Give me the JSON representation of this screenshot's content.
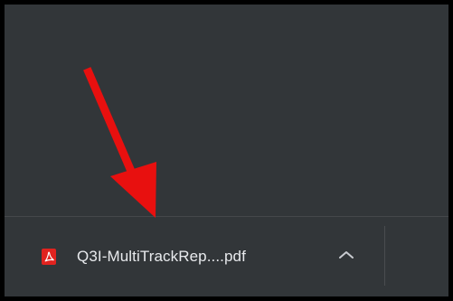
{
  "download_shelf": {
    "file_name": "Q3I-MultiTrackRep....pdf",
    "file_type_icon": "pdf-file-icon",
    "more_options_icon": "chevron-up-icon"
  },
  "annotation": {
    "arrow_icon": "red-arrow-annotation",
    "arrow_color": "#e8100f"
  },
  "colors": {
    "background": "#323639",
    "border": "#000000",
    "text": "#e8eaed",
    "pdf_icon": "#e1231f"
  }
}
